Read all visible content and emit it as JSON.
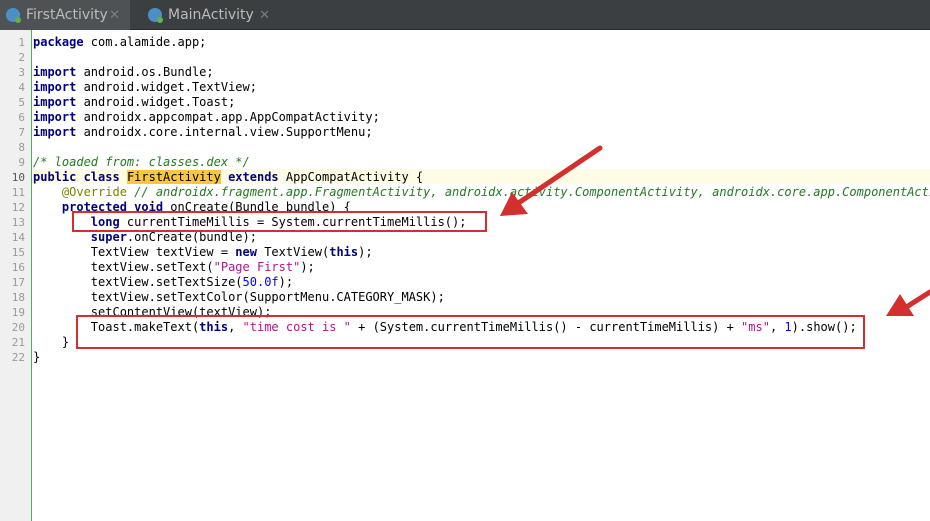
{
  "tabs": [
    {
      "label": "FirstActivity",
      "close": "✕"
    },
    {
      "label": "MainActivity",
      "close": "✕"
    }
  ],
  "line_numbers": [
    "1",
    "2",
    "3",
    "4",
    "5",
    "6",
    "7",
    "8",
    "9",
    "10",
    "11",
    "12",
    "13",
    "14",
    "15",
    "16",
    "17",
    "18",
    "19",
    "20",
    "21",
    "22"
  ],
  "code": {
    "l1": {
      "kw": "package",
      "rest": " com.alamide.app;"
    },
    "l3": {
      "kw": "import",
      "rest": " android.os.Bundle;"
    },
    "l4": {
      "kw": "import",
      "rest": " android.widget.TextView;"
    },
    "l5": {
      "kw": "import",
      "rest": " android.widget.Toast;"
    },
    "l6": {
      "kw": "import",
      "rest": " androidx.appcompat.app.AppCompatActivity;"
    },
    "l7": {
      "kw": "import",
      "rest": " androidx.core.internal.view.SupportMenu;"
    },
    "l9": {
      "comment": "/* loaded from: classes.dex */"
    },
    "l10": {
      "kw1": "public class",
      "cls": "FirstActivity",
      "kw2": " extends",
      "rest": " AppCompatActivity {"
    },
    "l11": {
      "ann": "@Override",
      "comment": " // androidx.fragment.app.FragmentActivity, androidx.activity.ComponentActivity, androidx.core.app.ComponentActivity"
    },
    "l12": {
      "kw": "protected void",
      "rest": " onCreate(Bundle bundle) {"
    },
    "l13": {
      "kw": "long",
      "rest1": " currentTimeMillis = System.currentTimeMillis();"
    },
    "l14": {
      "kw": "super",
      "rest": ".onCreate(bundle);"
    },
    "l15": {
      "pre": "TextView textView = ",
      "kw": "new",
      "rest": " TextView(",
      "kw2": "this",
      "post": ");"
    },
    "l16": {
      "pre": "textView.setText(",
      "str": "\"Page First\"",
      "post": ");"
    },
    "l17": {
      "pre": "textView.setTextSize(",
      "num": "50.0f",
      "post": ");"
    },
    "l18": {
      "text": "textView.setTextColor(SupportMenu.CATEGORY_MASK);"
    },
    "l19": {
      "text": "setContentView(textView);"
    },
    "l20": {
      "pre": "Toast.makeText(",
      "kw": "this",
      "mid1": ", ",
      "str1": "\"time cost is \"",
      "mid2": " + (System.currentTimeMillis() - currentTimeMillis) + ",
      "str2": "\"ms\"",
      "mid3": ", ",
      "num": "1",
      "post": ").show();"
    },
    "l21": {
      "text": "}"
    },
    "l22": {
      "text": "}"
    }
  },
  "annotation_color": "#d32f2f",
  "gutter_border_color": "#4caf50"
}
